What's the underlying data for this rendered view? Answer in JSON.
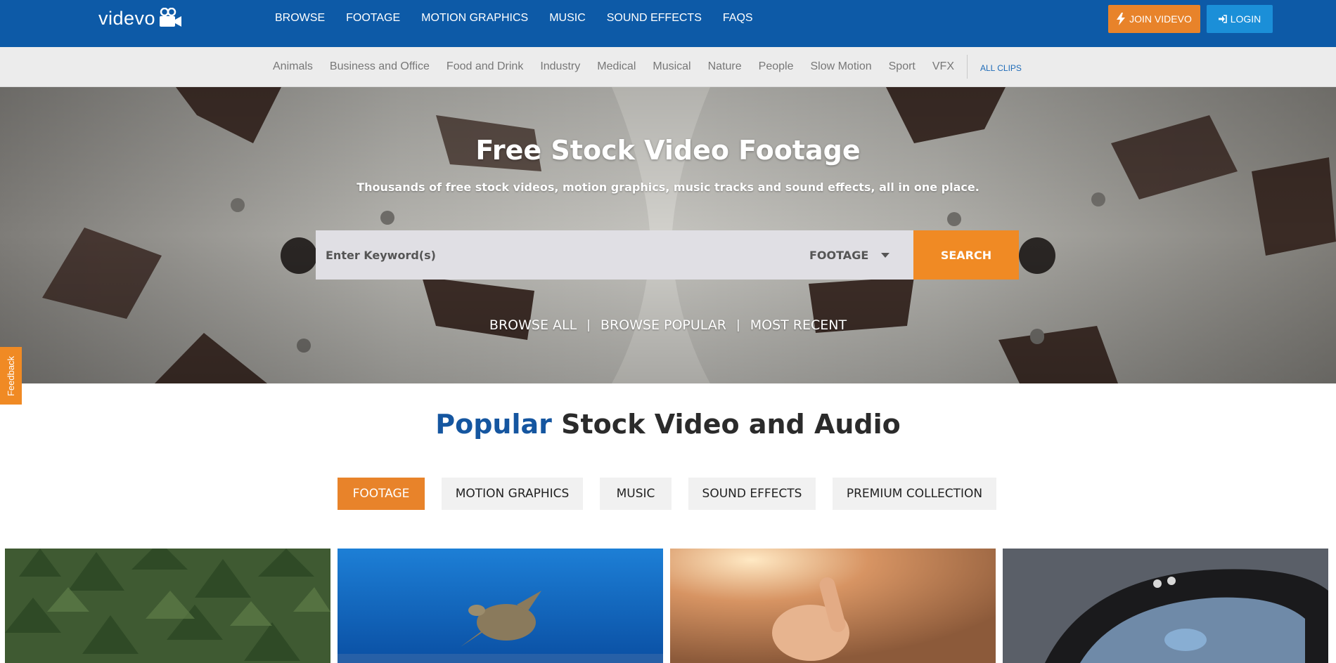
{
  "brand": {
    "name": "videvo"
  },
  "nav": {
    "items": [
      "BROWSE",
      "FOOTAGE",
      "MOTION GRAPHICS",
      "MUSIC",
      "SOUND EFFECTS",
      "FAQS"
    ],
    "join_label": "JOIN VIDEVO",
    "login_label": "LOGIN"
  },
  "categories": {
    "items": [
      "Animals",
      "Business and Office",
      "Food and Drink",
      "Industry",
      "Medical",
      "Musical",
      "Nature",
      "People",
      "Slow Motion",
      "Sport",
      "VFX"
    ],
    "all_label": "ALL CLIPS"
  },
  "hero": {
    "title": "Free Stock Video Footage",
    "subtitle": "Thousands of free stock videos, motion graphics, music tracks and sound effects, all in one place.",
    "search": {
      "placeholder": "Enter Keyword(s)",
      "type_selected": "FOOTAGE",
      "button_label": "SEARCH"
    },
    "links": [
      "BROWSE ALL",
      "BROWSE POPULAR",
      "MOST RECENT"
    ],
    "link_separator": "|"
  },
  "feedback_label": "Feedback",
  "popular": {
    "title_accent": "Popular",
    "title_rest": "Stock Video and Audio",
    "tabs": [
      "FOOTAGE",
      "MOTION GRAPHICS",
      "MUSIC",
      "SOUND EFFECTS",
      "PREMIUM COLLECTION"
    ],
    "active_tab": "FOOTAGE"
  },
  "colors": {
    "nav_bg": "#0d5aa7",
    "join_button": "#e8832a",
    "login_button": "#1b8fd8",
    "search_button": "#f08a24",
    "accent_blue": "#1556a0",
    "active_tab": "#e8832a"
  },
  "icons": {
    "logo": "movie-camera-icon",
    "join": "lightning-bolt-icon",
    "login": "sign-in-icon",
    "dropdown": "caret-down-icon"
  }
}
